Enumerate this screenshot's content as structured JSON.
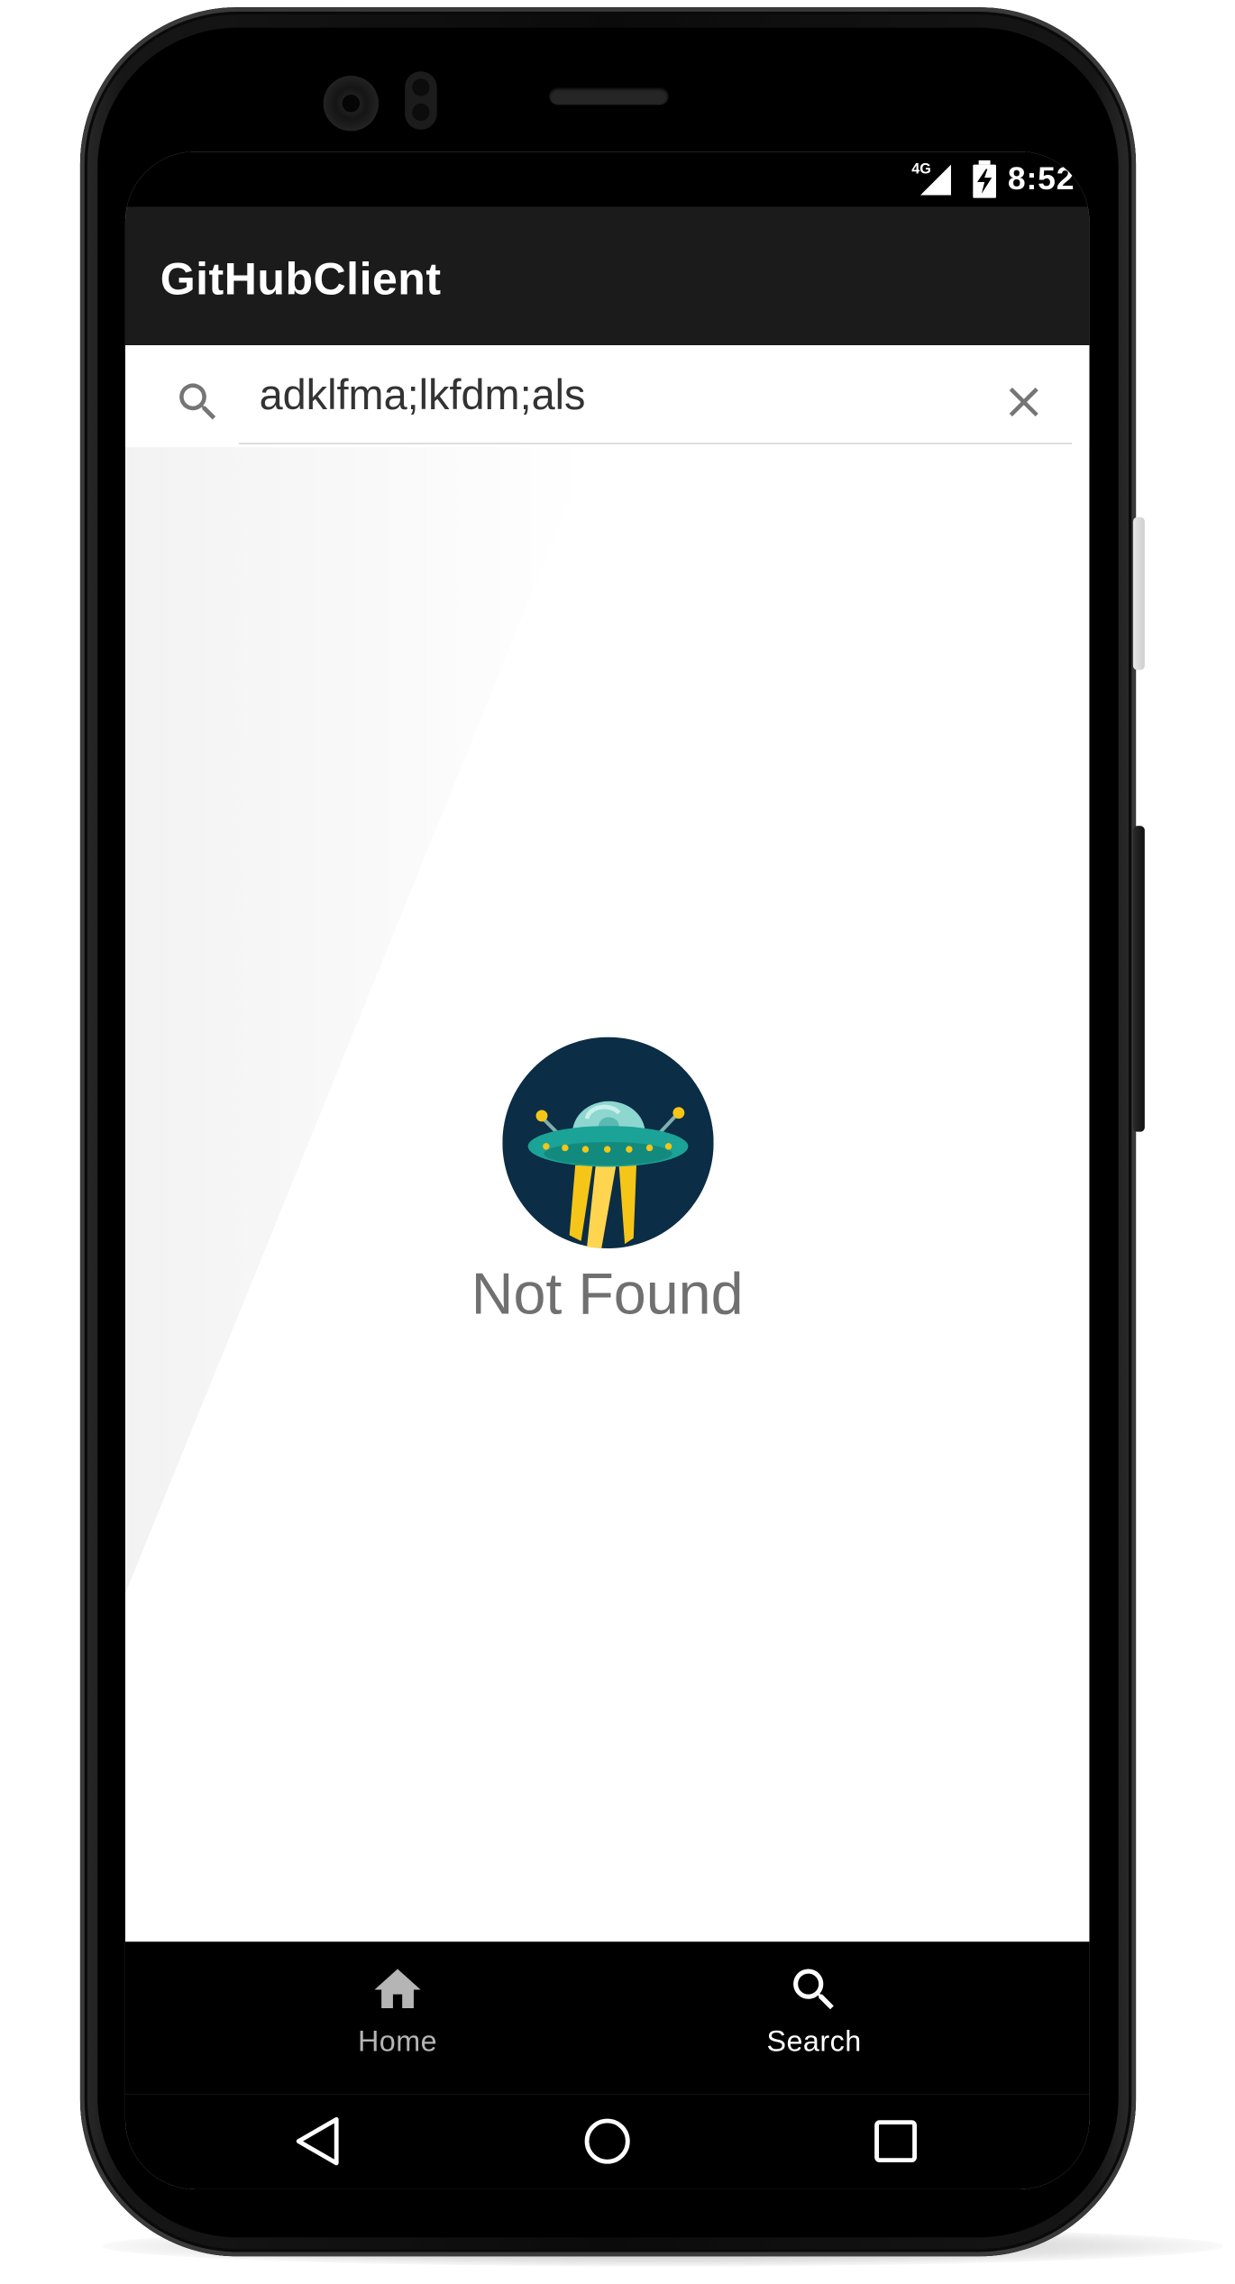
{
  "status_bar": {
    "network": "4G",
    "time": "8:52",
    "battery_state": "charging"
  },
  "app_bar": {
    "title": "GitHubClient"
  },
  "search": {
    "query": "adklfma;lkfdm;als",
    "icon": "search-icon",
    "clear_icon": "close-icon"
  },
  "empty_state": {
    "illustration": "ufo-icon",
    "message": "Not Found"
  },
  "bottom_nav": {
    "items": [
      {
        "label": "Home",
        "icon": "home-icon",
        "selected": false
      },
      {
        "label": "Search",
        "icon": "search-icon",
        "selected": true
      }
    ]
  },
  "system_nav": {
    "buttons": [
      "back-icon",
      "home-circle-icon",
      "recents-icon"
    ]
  },
  "colors": {
    "app_bar": "#1b1b1b",
    "status_bar": "#000000",
    "bottom_nav": "#000000",
    "empty_text": "#707070",
    "ufo_background": "#0b2d45",
    "ufo_saucer": "#1aa396",
    "ufo_beam": "#f5c518"
  }
}
